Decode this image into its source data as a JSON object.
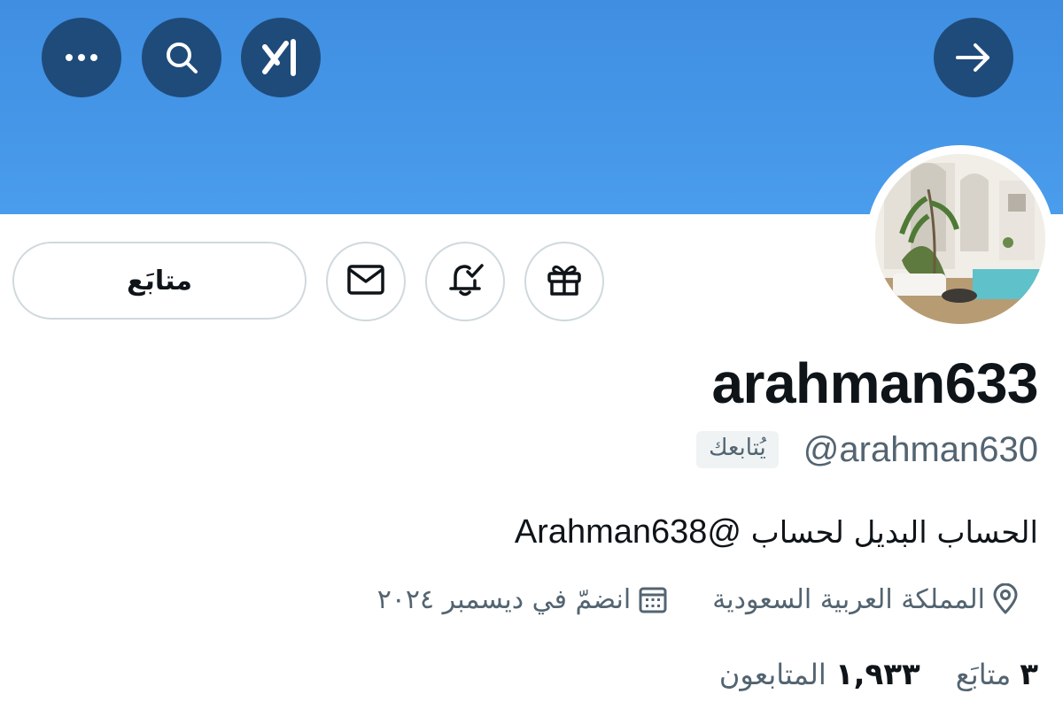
{
  "header": {
    "back_icon": "arrow-right-icon",
    "grok_icon": "grok-icon",
    "search_icon": "search-icon",
    "more_icon": "more-icon",
    "banner_color": "#4a9cec",
    "button_color": "#1f4b7a"
  },
  "actions": {
    "follow_label": "متابَع",
    "message_icon": "envelope-icon",
    "notify_icon": "bell-check-icon",
    "gift_icon": "gift-icon"
  },
  "profile": {
    "name": "arahman633",
    "handle": "@arahman630",
    "follows_you": "يُتابعك",
    "bio_text": "الحساب البديل لحساب ",
    "bio_mention": "@Arahman638",
    "location": "المملكة العربية السعودية",
    "joined": "انضمّ في ديسمبر ٢٠٢٤",
    "location_icon": "location-pin-icon",
    "calendar_icon": "calendar-icon"
  },
  "stats": {
    "following_count": "٣",
    "following_label": "متابَع",
    "followers_count": "١,٩٣٣",
    "followers_label": "المتابعون"
  }
}
